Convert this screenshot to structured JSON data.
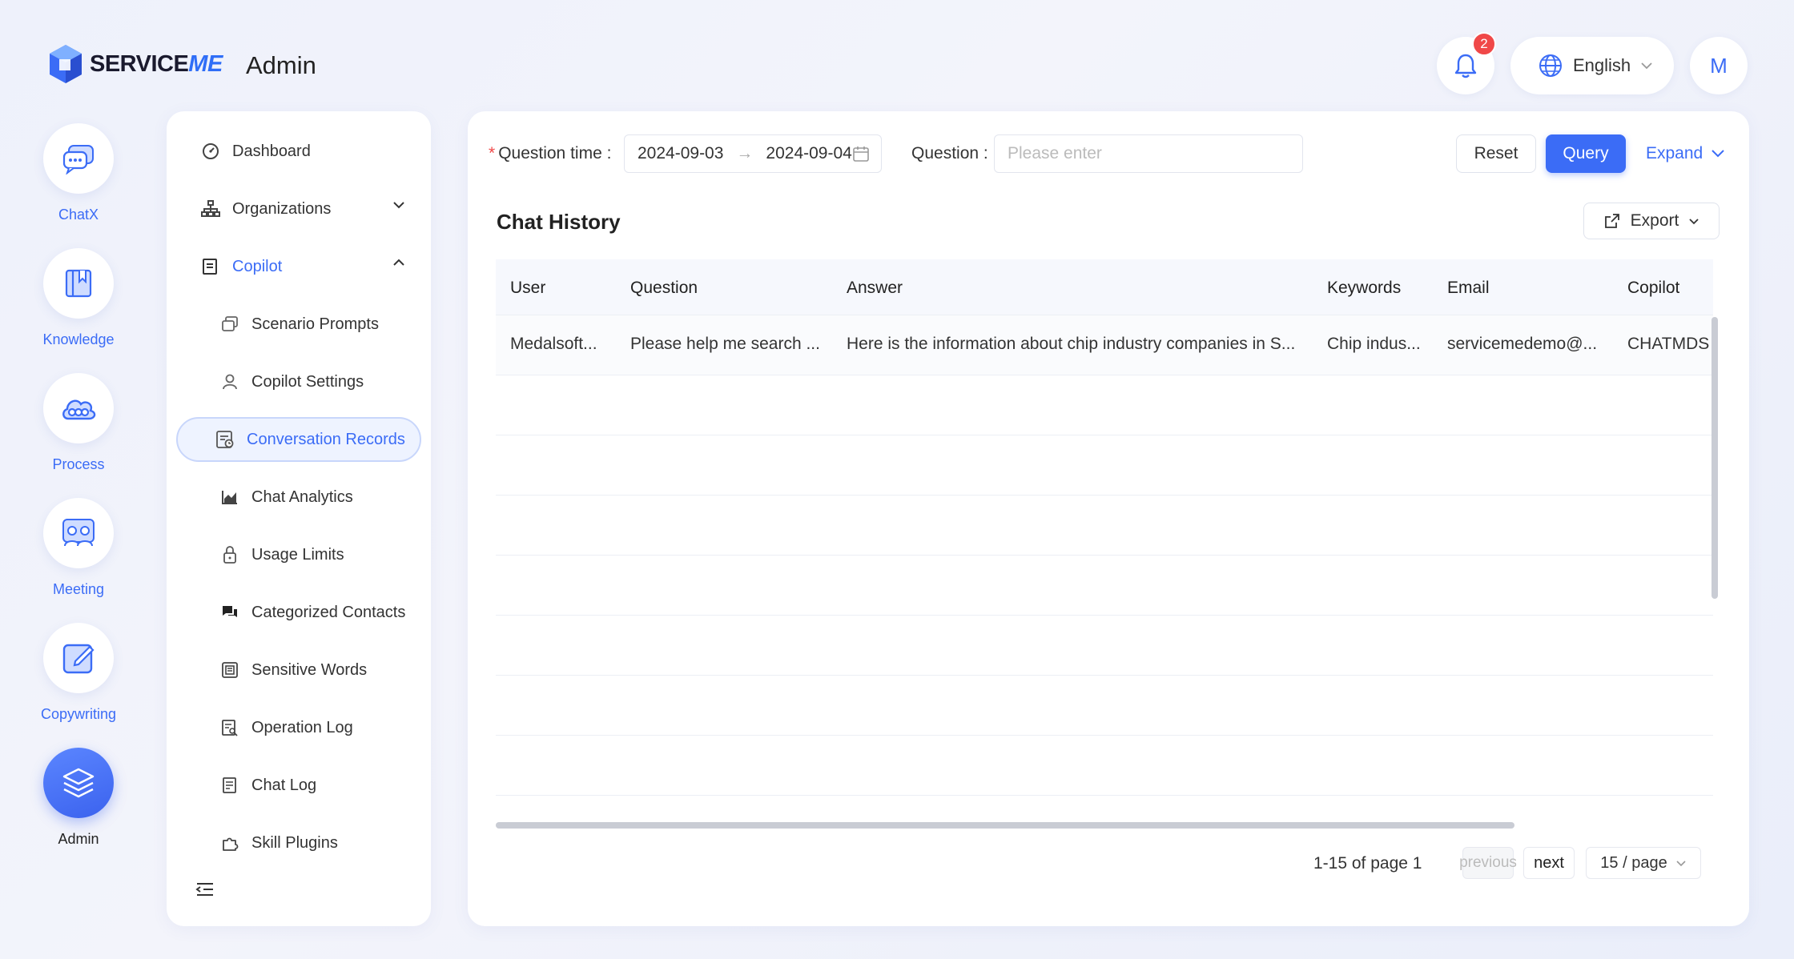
{
  "brand": {
    "name_part1": "SERVICE",
    "name_part2": "ME",
    "section": "Admin"
  },
  "header": {
    "notifications_count": "2",
    "language": "English",
    "avatar_initial": "M"
  },
  "apps": [
    {
      "label": "ChatX",
      "icon": "chat-bubble-icon"
    },
    {
      "label": "Knowledge",
      "icon": "book-icon"
    },
    {
      "label": "Process",
      "icon": "cloud-flow-icon"
    },
    {
      "label": "Meeting",
      "icon": "people-icon"
    },
    {
      "label": "Copywriting",
      "icon": "edit-square-icon"
    },
    {
      "label": "Admin",
      "icon": "layers-icon"
    }
  ],
  "menu": {
    "dashboard": "Dashboard",
    "organizations": "Organizations",
    "copilot": "Copilot",
    "scenario_prompts": "Scenario Prompts",
    "copilot_settings": "Copilot Settings",
    "conversation_records": "Conversation Records",
    "chat_analytics": "Chat Analytics",
    "usage_limits": "Usage Limits",
    "categorized_contacts": "Categorized Contacts",
    "sensitive_words": "Sensitive Words",
    "operation_log": "Operation Log",
    "chat_log": "Chat Log",
    "skill_plugins": "Skill Plugins"
  },
  "filters": {
    "question_time_label": "Question time",
    "date_start": "2024-09-03",
    "date_end": "2024-09-04",
    "question_label": "Question",
    "question_placeholder": "Please enter",
    "reset": "Reset",
    "query": "Query",
    "expand": "Expand"
  },
  "table": {
    "title": "Chat History",
    "export": "Export",
    "columns": [
      "User",
      "Question",
      "Answer",
      "Keywords",
      "Email",
      "Copilot"
    ],
    "rows": [
      [
        "Medalsoft...",
        "Please help me search ...",
        "Here is the information about chip industry companies in S...",
        "Chip indus...",
        "servicemedemo@...",
        "CHATMDS"
      ]
    ]
  },
  "pagination": {
    "info": "1-15 of page 1",
    "previous": "previous",
    "next": "next",
    "page_size": "15 / page"
  }
}
